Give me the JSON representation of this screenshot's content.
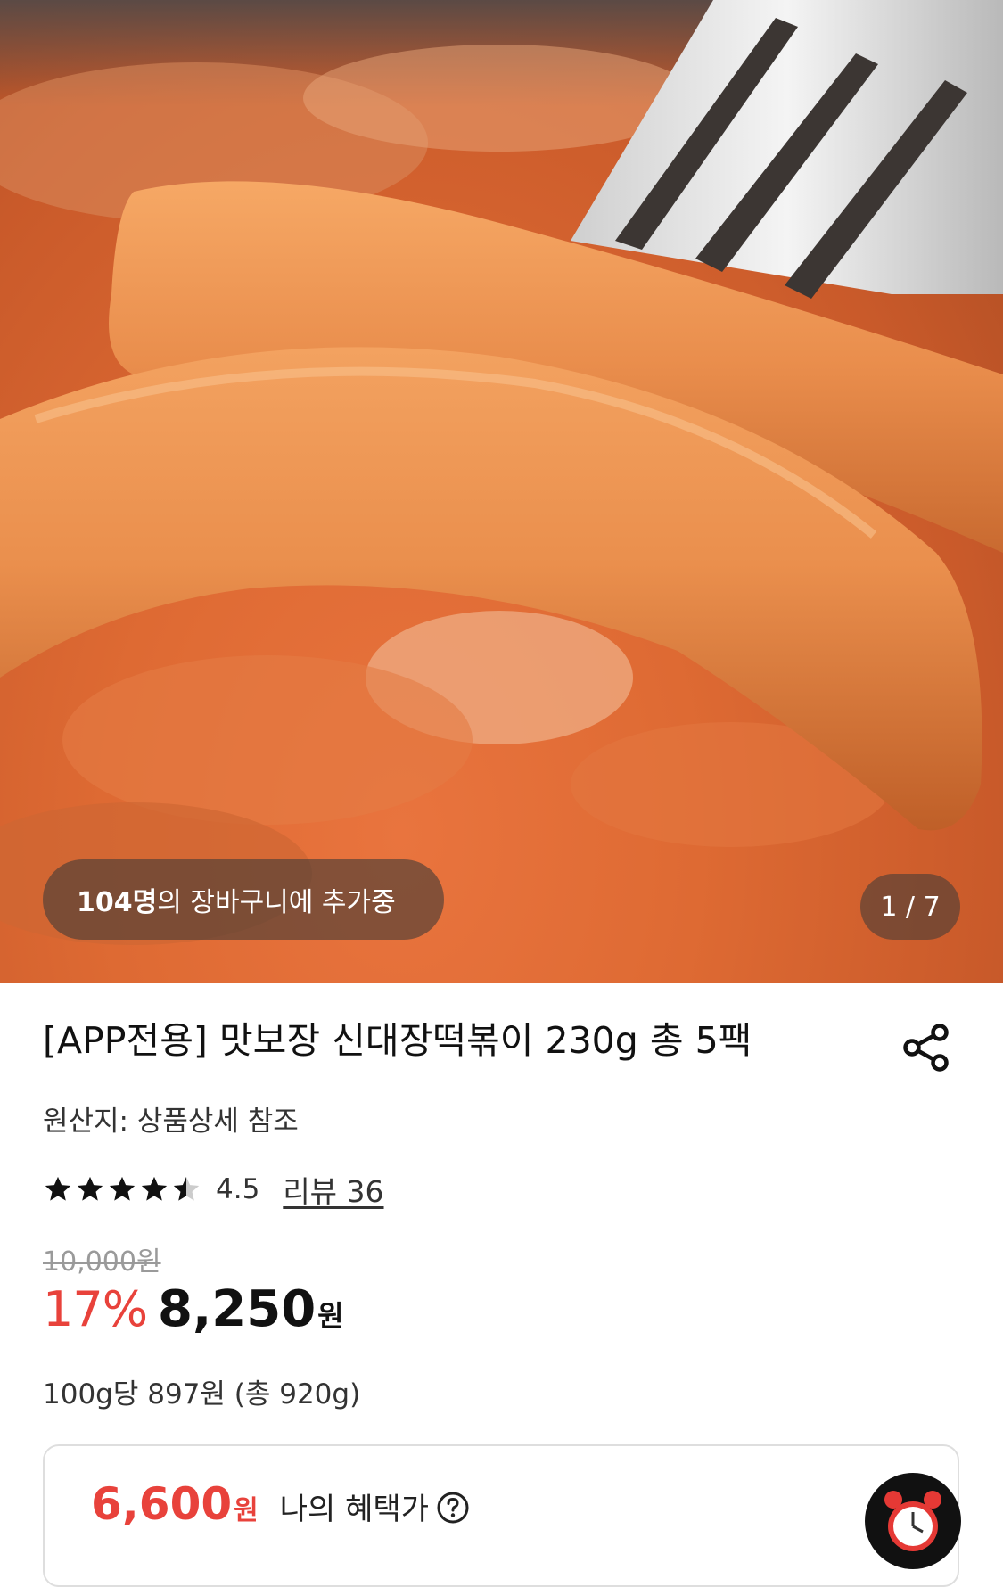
{
  "hero": {
    "cart_count": "104명",
    "cart_suffix": "의 장바구니에 추가중",
    "image_counter": "1 / 7"
  },
  "product": {
    "title": "[APP전용] 맛보장 신대장떡볶이 230g 총 5팩",
    "origin": "원산지: 상품상세 참조",
    "rating": 4.5,
    "rating_label": "4.5",
    "review_link": "리뷰 36",
    "original_price": "10,000원",
    "discount": "17%",
    "sale_price": "8,250",
    "currency": "원",
    "unit_price": "100g당 897원 (총 920g)"
  },
  "benefit": {
    "amount": "6,600",
    "currency": "원",
    "label": "나의 혜택가"
  },
  "icons": [
    "share-icon",
    "star-icon",
    "help-icon",
    "alarm-clock-icon"
  ],
  "colors": {
    "accent": "#e8423b",
    "text": "#111111"
  }
}
